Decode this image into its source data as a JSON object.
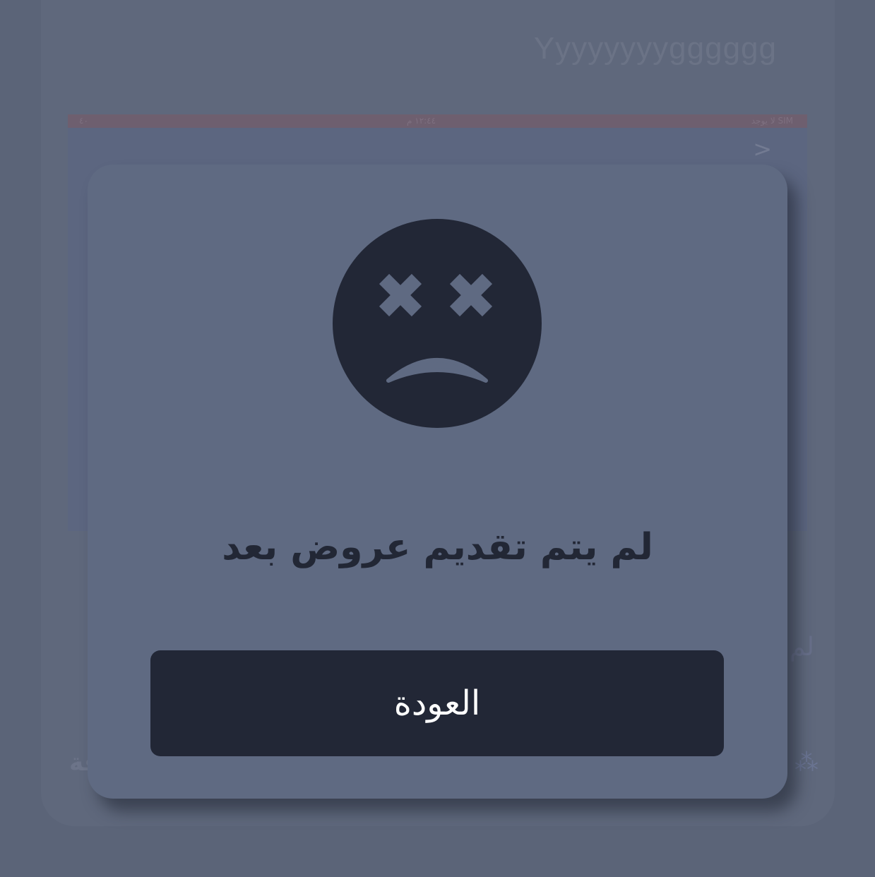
{
  "background": {
    "title": "Yyyyyyyygggggg",
    "status_bar": {
      "carrier": "لا يوجد SIM",
      "time": "١٢:٤٤ م",
      "battery": "٤٠"
    },
    "back_icon": "chevron-right-icon",
    "side_text_right": "لم",
    "side_text_left": "قة",
    "side_icon_right": "people-icon"
  },
  "dialog": {
    "icon": "sad-face-icon",
    "message": "لم يتم تقديم عروض بعد",
    "back_button_label": "العودة"
  },
  "colors": {
    "overlay": "#5b6478",
    "dialog_bg": "#5f6a82",
    "dark": "#222736",
    "button_text": "#ffffff"
  }
}
